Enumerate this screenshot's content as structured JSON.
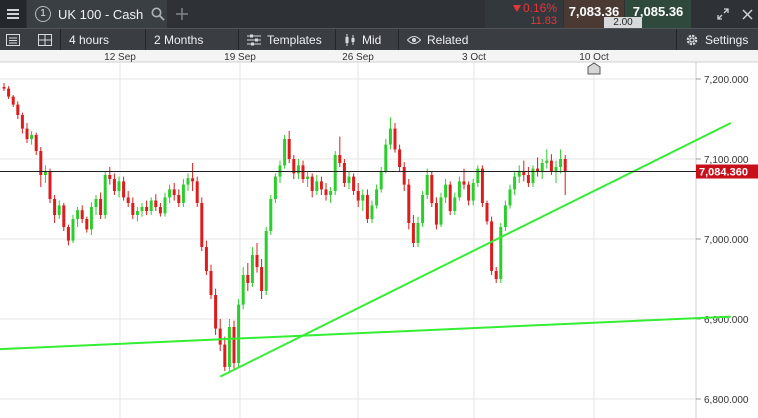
{
  "topbar": {
    "menu_icon": "hamburger-menu-icon",
    "instrument_index": "1",
    "instrument_name": "UK 100 - Cash",
    "search_icon": "search-icon",
    "add_icon": "plus-icon",
    "change_percent": "0.16%",
    "change_points": "11.83",
    "sell_price": "7,083.36",
    "buy_price": "7,085.36",
    "spread": "2.00",
    "expand_icon": "expand-icon",
    "close_icon": "close-icon"
  },
  "toolbar": {
    "list_icon": "list-icon",
    "layout_icon": "grid-layout-icon",
    "interval": "4 hours",
    "range": "2 Months",
    "templates": "Templates",
    "mid": "Mid",
    "related": "Related",
    "settings": "Settings"
  },
  "colors": {
    "up": "#2ccd2c",
    "down": "#dd1d1d",
    "trendline": "#33ee33",
    "price_label_bg": "#c8101a",
    "grid": "#e6e6e6"
  },
  "chart_data": {
    "type": "candlestick",
    "x_tick_labels": [
      "12 Sep",
      "19 Sep",
      "26 Sep",
      "3 Oct",
      "10 Oct"
    ],
    "y_tick_labels": [
      "7,200.000",
      "7,100.000",
      "7,000.000",
      "6,900.000",
      "6,800.000"
    ],
    "y_ticks": [
      7200,
      7100,
      7000,
      6900,
      6800
    ],
    "ylim": [
      6790,
      7240
    ],
    "current_price": 7084.36,
    "current_price_label": "7,084.360",
    "grid": true,
    "candles_ohlc": [
      [
        7190,
        7195,
        7185,
        7188
      ],
      [
        7188,
        7191,
        7175,
        7178
      ],
      [
        7178,
        7180,
        7165,
        7168
      ],
      [
        7168,
        7172,
        7150,
        7155
      ],
      [
        7155,
        7158,
        7132,
        7138
      ],
      [
        7138,
        7145,
        7120,
        7125
      ],
      [
        7125,
        7135,
        7118,
        7130
      ],
      [
        7130,
        7133,
        7105,
        7110
      ],
      [
        7110,
        7115,
        7065,
        7080
      ],
      [
        7080,
        7092,
        7070,
        7085
      ],
      [
        7085,
        7088,
        7045,
        7050
      ],
      [
        7050,
        7055,
        7020,
        7030
      ],
      [
        7030,
        7048,
        7025,
        7042
      ],
      [
        7042,
        7045,
        7010,
        7015
      ],
      [
        7015,
        7018,
        6992,
        6998
      ],
      [
        6998,
        7030,
        6995,
        7025
      ],
      [
        7025,
        7040,
        7015,
        7036
      ],
      [
        7036,
        7042,
        7020,
        7025
      ],
      [
        7025,
        7028,
        7008,
        7012
      ],
      [
        7012,
        7046,
        7005,
        7040
      ],
      [
        7040,
        7055,
        7030,
        7050
      ],
      [
        7050,
        7058,
        7025,
        7030
      ],
      [
        7030,
        7085,
        7025,
        7080
      ],
      [
        7080,
        7090,
        7068,
        7075
      ],
      [
        7075,
        7082,
        7055,
        7060
      ],
      [
        7060,
        7078,
        7052,
        7072
      ],
      [
        7072,
        7078,
        7048,
        7052
      ],
      [
        7052,
        7060,
        7040,
        7045
      ],
      [
        7045,
        7052,
        7025,
        7030
      ],
      [
        7030,
        7040,
        7022,
        7035
      ],
      [
        7035,
        7045,
        7028,
        7040
      ],
      [
        7040,
        7048,
        7030,
        7035
      ],
      [
        7035,
        7052,
        7030,
        7048
      ],
      [
        7048,
        7056,
        7035,
        7040
      ],
      [
        7040,
        7045,
        7028,
        7032
      ],
      [
        7032,
        7058,
        7028,
        7052
      ],
      [
        7052,
        7068,
        7045,
        7062
      ],
      [
        7062,
        7070,
        7048,
        7055
      ],
      [
        7055,
        7062,
        7040,
        7045
      ],
      [
        7045,
        7075,
        7040,
        7068
      ],
      [
        7068,
        7082,
        7060,
        7076
      ],
      [
        7076,
        7095,
        7060,
        7072
      ],
      [
        7072,
        7078,
        7040,
        7045
      ],
      [
        7045,
        7052,
        6985,
        6990
      ],
      [
        6990,
        6998,
        6955,
        6960
      ],
      [
        6960,
        6968,
        6925,
        6930
      ],
      [
        6930,
        6938,
        6880,
        6888
      ],
      [
        6888,
        6900,
        6860,
        6868
      ],
      [
        6868,
        6878,
        6835,
        6840
      ],
      [
        6840,
        6900,
        6832,
        6890
      ],
      [
        6890,
        6898,
        6838,
        6845
      ],
      [
        6845,
        6925,
        6840,
        6918
      ],
      [
        6918,
        6965,
        6912,
        6955
      ],
      [
        6955,
        6970,
        6935,
        6945
      ],
      [
        6945,
        6990,
        6940,
        6980
      ],
      [
        6980,
        6995,
        6958,
        6965
      ],
      [
        6965,
        6975,
        6925,
        6935
      ],
      [
        6935,
        7015,
        6930,
        7010
      ],
      [
        7010,
        7055,
        7005,
        7050
      ],
      [
        7050,
        7082,
        7045,
        7078
      ],
      [
        7078,
        7098,
        7070,
        7092
      ],
      [
        7092,
        7130,
        7088,
        7125
      ],
      [
        7125,
        7135,
        7095,
        7100
      ],
      [
        7100,
        7105,
        7075,
        7082
      ],
      [
        7082,
        7100,
        7075,
        7092
      ],
      [
        7092,
        7098,
        7070,
        7075
      ],
      [
        7075,
        7085,
        7065,
        7078
      ],
      [
        7078,
        7082,
        7052,
        7060
      ],
      [
        7060,
        7080,
        7055,
        7072
      ],
      [
        7072,
        7078,
        7055,
        7062
      ],
      [
        7062,
        7070,
        7048,
        7055
      ],
      [
        7055,
        7065,
        7045,
        7060
      ],
      [
        7060,
        7110,
        7055,
        7105
      ],
      [
        7105,
        7128,
        7090,
        7095
      ],
      [
        7095,
        7100,
        7065,
        7070
      ],
      [
        7070,
        7085,
        7062,
        7078
      ],
      [
        7078,
        7082,
        7055,
        7060
      ],
      [
        7060,
        7070,
        7040,
        7048
      ],
      [
        7048,
        7062,
        7035,
        7055
      ],
      [
        7055,
        7062,
        7020,
        7025
      ],
      [
        7025,
        7048,
        7020,
        7042
      ],
      [
        7042,
        7068,
        7038,
        7062
      ],
      [
        7062,
        7090,
        7058,
        7085
      ],
      [
        7085,
        7125,
        7082,
        7118
      ],
      [
        7118,
        7152,
        7112,
        7138
      ],
      [
        7138,
        7145,
        7108,
        7112
      ],
      [
        7112,
        7118,
        7085,
        7090
      ],
      [
        7090,
        7096,
        7060,
        7068
      ],
      [
        7068,
        7075,
        7012,
        7020
      ],
      [
        7020,
        7030,
        6990,
        6995
      ],
      [
        6995,
        7028,
        6990,
        7020
      ],
      [
        7020,
        7060,
        7015,
        7055
      ],
      [
        7055,
        7088,
        7050,
        7080
      ],
      [
        7080,
        7085,
        7040,
        7045
      ],
      [
        7045,
        7052,
        7012,
        7018
      ],
      [
        7018,
        7058,
        7015,
        7052
      ],
      [
        7052,
        7075,
        7045,
        7068
      ],
      [
        7068,
        7072,
        7030,
        7035
      ],
      [
        7035,
        7058,
        7030,
        7052
      ],
      [
        7052,
        7078,
        7048,
        7072
      ],
      [
        7072,
        7088,
        7062,
        7068
      ],
      [
        7068,
        7072,
        7042,
        7048
      ],
      [
        7048,
        7075,
        7042,
        7070
      ],
      [
        7070,
        7092,
        7065,
        7088
      ],
      [
        7088,
        7092,
        7040,
        7045
      ],
      [
        7045,
        7048,
        7018,
        7022
      ],
      [
        7022,
        7028,
        6955,
        6960
      ],
      [
        6960,
        6965,
        6945,
        6950
      ],
      [
        6950,
        7020,
        6945,
        7015
      ],
      [
        7015,
        7048,
        7010,
        7042
      ],
      [
        7042,
        7068,
        7038,
        7062
      ],
      [
        7062,
        7085,
        7055,
        7078
      ],
      [
        7078,
        7092,
        7070,
        7085
      ],
      [
        7085,
        7098,
        7072,
        7080
      ],
      [
        7080,
        7090,
        7065,
        7070
      ],
      [
        7070,
        7092,
        7065,
        7088
      ],
      [
        7088,
        7102,
        7078,
        7084
      ],
      [
        7084,
        7100,
        7075,
        7095
      ],
      [
        7095,
        7112,
        7088,
        7098
      ],
      [
        7098,
        7106,
        7080,
        7085
      ],
      [
        7085,
        7098,
        7070,
        7090
      ],
      [
        7090,
        7112,
        7082,
        7100
      ],
      [
        7100,
        7105,
        7055,
        7085
      ]
    ],
    "trendlines": [
      {
        "from": {
          "candle": 47,
          "price": 6828
        },
        "to": {
          "candle": 158,
          "price": 7145
        }
      },
      {
        "from": {
          "candle": -2,
          "price": 6862
        },
        "to": {
          "candle": 158,
          "price": 6903
        }
      }
    ]
  }
}
